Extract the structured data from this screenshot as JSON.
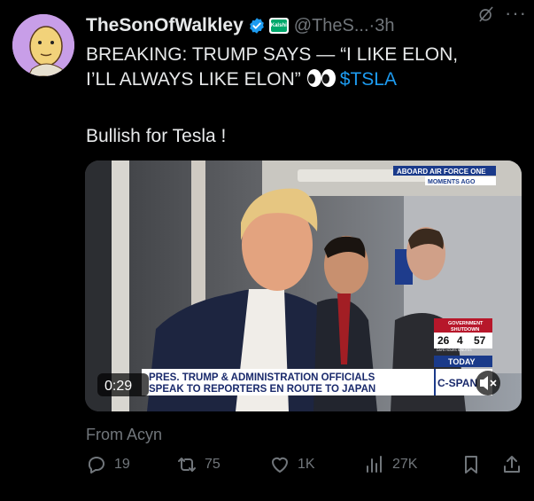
{
  "tweet": {
    "author_name": "TheSonOfWalkley",
    "handle": "@TheS...",
    "separator": "·",
    "time": "3h",
    "affiliate_badge_text": "Kalshi",
    "text_line1": "BREAKING: TRUMP SAYS — “I LIKE ELON,",
    "text_line2": "I’LL ALWAYS LIKE ELON”",
    "cashtag": "$TSLA",
    "body_paragraph": "Bullish for Tesla !",
    "attribution": "From Acyn"
  },
  "video": {
    "duration": "0:29",
    "overlay_top_line1": "ABOARD AIR FORCE ONE",
    "overlay_top_line2": "MOMENTS AGO",
    "lower_third_line1": "PRES. TRUMP & ADMINISTRATION OFFICIALS",
    "lower_third_line2": "SPEAK TO REPORTERS EN ROUTE TO JAPAN",
    "network": "C-SPAN",
    "shutdown_label_1": "GOVERNMENT",
    "shutdown_label_2": "SHUTDOWN",
    "counter_days": "26",
    "counter_hours": "4",
    "counter_minutes": "57",
    "counter_units": "DAYS  HOURS  MINUTES",
    "today_label": "TODAY"
  },
  "actions": {
    "replies": "19",
    "reposts": "75",
    "likes": "1K",
    "views": "27K"
  },
  "colors": {
    "background": "#000000",
    "text": "#e7e9ea",
    "muted": "#71767b",
    "accent": "#1d9bf0"
  },
  "icons": [
    "verified-badge-icon",
    "affiliate-badge-icon",
    "grok-icon",
    "more-icon",
    "eyes-emoji-icon",
    "mute-icon",
    "reply-icon",
    "repost-icon",
    "like-icon",
    "views-icon",
    "bookmark-icon",
    "share-icon"
  ]
}
